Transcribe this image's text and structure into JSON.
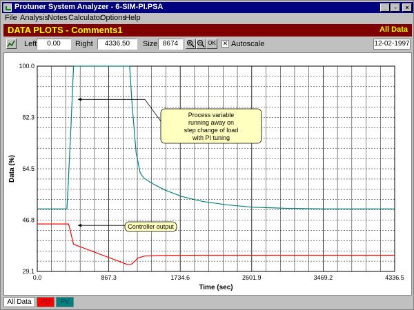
{
  "window": {
    "title": "Protuner System Analyzer - 6-SIM-PI.PSA",
    "controls": {
      "minimize": "_",
      "restore": "▫",
      "close": "×"
    }
  },
  "menu": {
    "items": [
      "File",
      "Analysis",
      "Notes",
      "Calculator",
      "Options",
      "Help"
    ]
  },
  "header": {
    "title": "DATA PLOTS - Comments1",
    "right_label": "All Data"
  },
  "toolbar": {
    "left_label": "Left",
    "left_value": "0.00",
    "right_label": "Right",
    "right_value": "4336.50",
    "size_label": "Size",
    "size_value": "8674",
    "zoom_in_icon": "zoom-in-icon",
    "zoom_out_icon": "zoom-out-icon",
    "ok_label": "OK",
    "autoscale_label": "Autoscale",
    "autoscale_checked": true,
    "date": "12-02-1997"
  },
  "chart_data": {
    "type": "line",
    "xlabel": "Time (sec)",
    "ylabel": "Data (%)",
    "xlim": [
      0.0,
      4336.5
    ],
    "ylim": [
      29.1,
      100.0
    ],
    "x_ticks": [
      "0.0",
      "867.3",
      "1734.6",
      "2601.9",
      "3469.2",
      "4336.5"
    ],
    "y_ticks": [
      "100.0",
      "82.3",
      "64.5",
      "46.8",
      "29.1"
    ],
    "grid": true,
    "series": [
      {
        "color": "#008080",
        "x": [
          0,
          360,
          380,
          410,
          440,
          1120,
          1150,
          1200,
          1250,
          1300,
          1400,
          1550,
          1750,
          2000,
          2300,
          2600,
          3000,
          3500,
          4000,
          4336.5
        ],
        "y": [
          50.7,
          50.7,
          62.0,
          80.0,
          100.0,
          100.0,
          87.0,
          70.0,
          63.0,
          61.2,
          59.4,
          57.2,
          55.0,
          53.3,
          52.1,
          51.3,
          50.9,
          50.7,
          50.7,
          50.7
        ]
      },
      {
        "color": "#ff0000",
        "x": [
          0,
          380,
          440,
          1100,
          1150,
          1220,
          1300,
          1500,
          2000,
          3000,
          4336.5
        ],
        "y": [
          45.5,
          45.5,
          38.5,
          31.4,
          31.7,
          33.7,
          34.4,
          34.6,
          34.7,
          34.7,
          34.7
        ]
      }
    ],
    "annotations": [
      {
        "text": [
          "Process variable",
          "running away on",
          "step change of load",
          "with PI tuning"
        ],
        "arrow_to": [
          480,
          88.5
        ]
      },
      {
        "text": [
          "Controller output"
        ],
        "arrow_to": [
          480,
          45.0
        ]
      }
    ]
  },
  "tabs": [
    {
      "label": "All Data",
      "bg": "#ffffff",
      "fg": "#000000"
    },
    {
      "label": "PD",
      "bg": "#ff0000",
      "fg": "#800000"
    },
    {
      "label": "PV",
      "bg": "#008080",
      "fg": "#004040"
    }
  ]
}
